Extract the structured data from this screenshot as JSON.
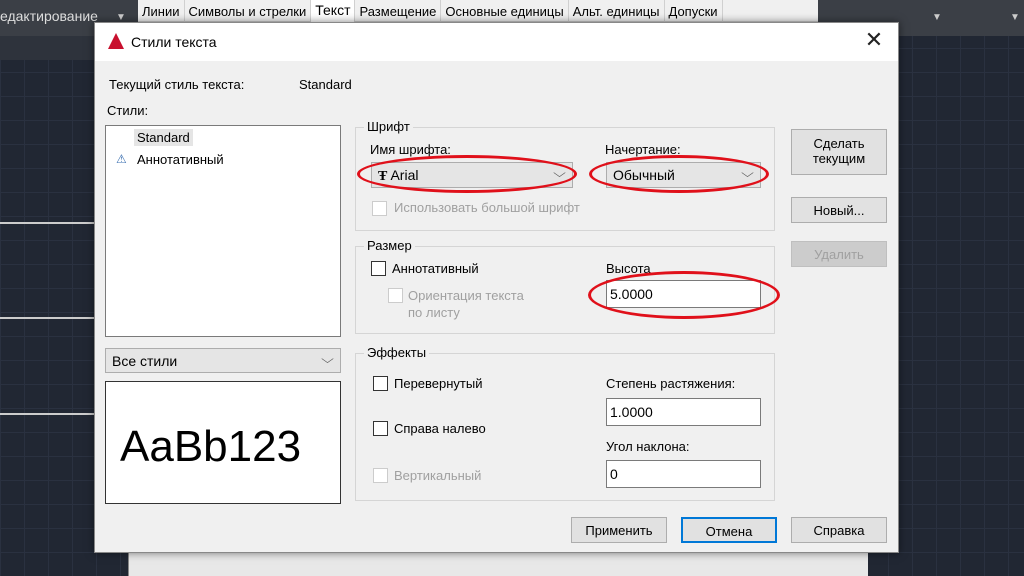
{
  "ribbon": {
    "left_label": "едактирование",
    "tabs": [
      "Линии",
      "Символы и стрелки",
      "Текст",
      "Размещение",
      "Основные единицы",
      "Альт. единицы",
      "Допуски"
    ],
    "active_tab": "Текст"
  },
  "dialog": {
    "title": "Стили текста",
    "current_style_label": "Текущий стиль текста:",
    "current_style_value": "Standard",
    "styles_label": "Стили:",
    "styles": [
      "Standard",
      "Аннотативный"
    ],
    "filter_value": "Все стили",
    "preview_text": "AaBb123",
    "font": {
      "group": "Шрифт",
      "name_label": "Имя шрифта:",
      "name_value": "Arial",
      "style_label": "Начертание:",
      "style_value": "Обычный",
      "big_font_label": "Использовать большой шрифт"
    },
    "size": {
      "group": "Размер",
      "annotative_label": "Аннотативный",
      "orientation_label_1": "Ориентация текста",
      "orientation_label_2": "по листу",
      "height_label": "Высота",
      "height_value": "5.0000"
    },
    "effects": {
      "group": "Эффекты",
      "upside_down": "Перевернутый",
      "backwards": "Справа налево",
      "vertical": "Вертикальный",
      "width_label": "Степень растяжения:",
      "width_value": "1.0000",
      "oblique_label": "Угол наклона:",
      "oblique_value": "0"
    },
    "buttons": {
      "set_current_1": "Сделать",
      "set_current_2": "текущим",
      "new": "Новый...",
      "delete": "Удалить",
      "apply": "Применить",
      "cancel": "Отмена",
      "help": "Справка"
    }
  },
  "colors": {
    "annotation": "#e0101a",
    "accent": "#0078d7",
    "canvas": "#212733"
  }
}
